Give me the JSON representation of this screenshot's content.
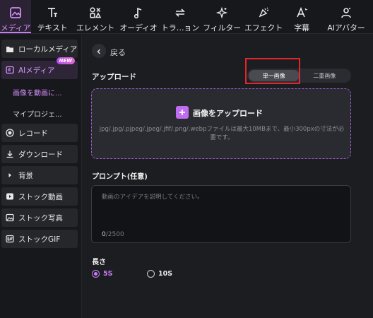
{
  "toolbar": {
    "tabs": [
      {
        "label": "メディア",
        "icon": "media-icon",
        "active": true
      },
      {
        "label": "テキスト",
        "icon": "text-icon"
      },
      {
        "label": "エレメント",
        "icon": "elements-icon"
      },
      {
        "label": "オーディオ",
        "icon": "music-note-icon"
      },
      {
        "label": "トラ…ョン",
        "icon": "transition-icon"
      },
      {
        "label": "フィルター",
        "icon": "sparkle-icon"
      },
      {
        "label": "エフェクト",
        "icon": "effect-icon"
      },
      {
        "label": "字幕",
        "icon": "caption-icon"
      },
      {
        "label": "AIアバター",
        "icon": "avatar-icon"
      }
    ]
  },
  "sidebar": {
    "local_media": "ローカルメディア",
    "ai_media": "AIメディア",
    "new_badge": "NEW",
    "sub_image_to_video": "画像を動画に...",
    "sub_my_projects": "マイプロジェ...",
    "record": "レコード",
    "download": "ダウンロード",
    "background": "背景",
    "stock_video": "ストック動画",
    "stock_photo": "ストック写真",
    "stock_gif": "ストックGIF"
  },
  "main": {
    "back_label": "戻る",
    "upload_title": "アップロード",
    "mode_single": "単一画像",
    "mode_double": "二重画像",
    "upload_button": "画像をアップロード",
    "upload_note": "jpg/.jpg/.pjpeg/.jpeg/.jfif/.png/.webpファイルは最大10MBまで、最小300pxの寸法が必要です。",
    "prompt_title": "プロンプト(任意)",
    "prompt_placeholder": "動画のアイデアを説明してください。",
    "prompt_count_current": "0",
    "prompt_count_max": "/2500",
    "length_title": "長さ",
    "length_5s": "5S",
    "length_10s": "10S"
  },
  "colors": {
    "accent": "#c77cf5",
    "highlight": "#e3262c",
    "background": "#1c1d21"
  }
}
